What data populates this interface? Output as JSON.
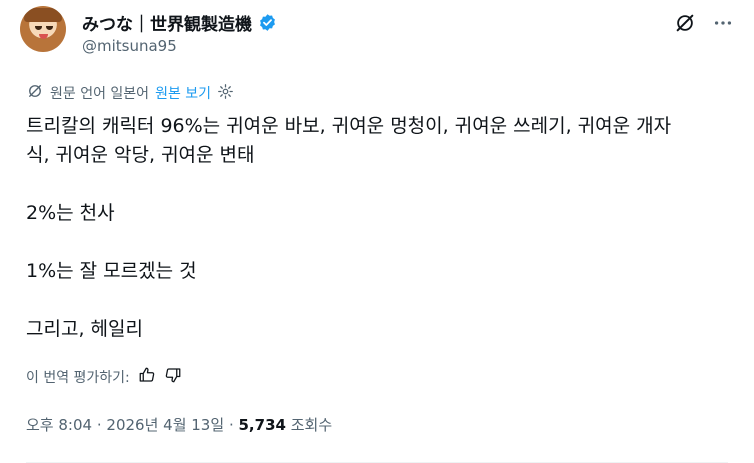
{
  "author": {
    "display_name": "みつな｜世界観製造機",
    "handle": "@mitsuna95",
    "verified_color": "#1d9bf0"
  },
  "translate": {
    "source_label": "원문 언어 일본어",
    "view_original_label": "원본 보기"
  },
  "post": {
    "lines": [
      "트리칼의 캐릭터 96%는 귀여운 바보, 귀여운 멍청이, 귀여운 쓰레기, 귀여운 개자",
      "식, 귀여운 악당, 귀여운 변태",
      "2%는 천사",
      "1%는 잘 모르겠는 것",
      "그리고, 헤일리"
    ]
  },
  "rate": {
    "label": "이 번역 평가하기:"
  },
  "meta": {
    "time": "오후 8:04",
    "separator": "·",
    "date": "2026년 4월 13일",
    "views_count": "5,734",
    "views_label": "조회수"
  },
  "icons": {
    "grok": "grok-icon",
    "more": "more-icon",
    "translate": "translate-icon",
    "settings": "gear-icon",
    "thumbs_up": "thumbs-up-icon",
    "thumbs_down": "thumbs-down-icon"
  }
}
